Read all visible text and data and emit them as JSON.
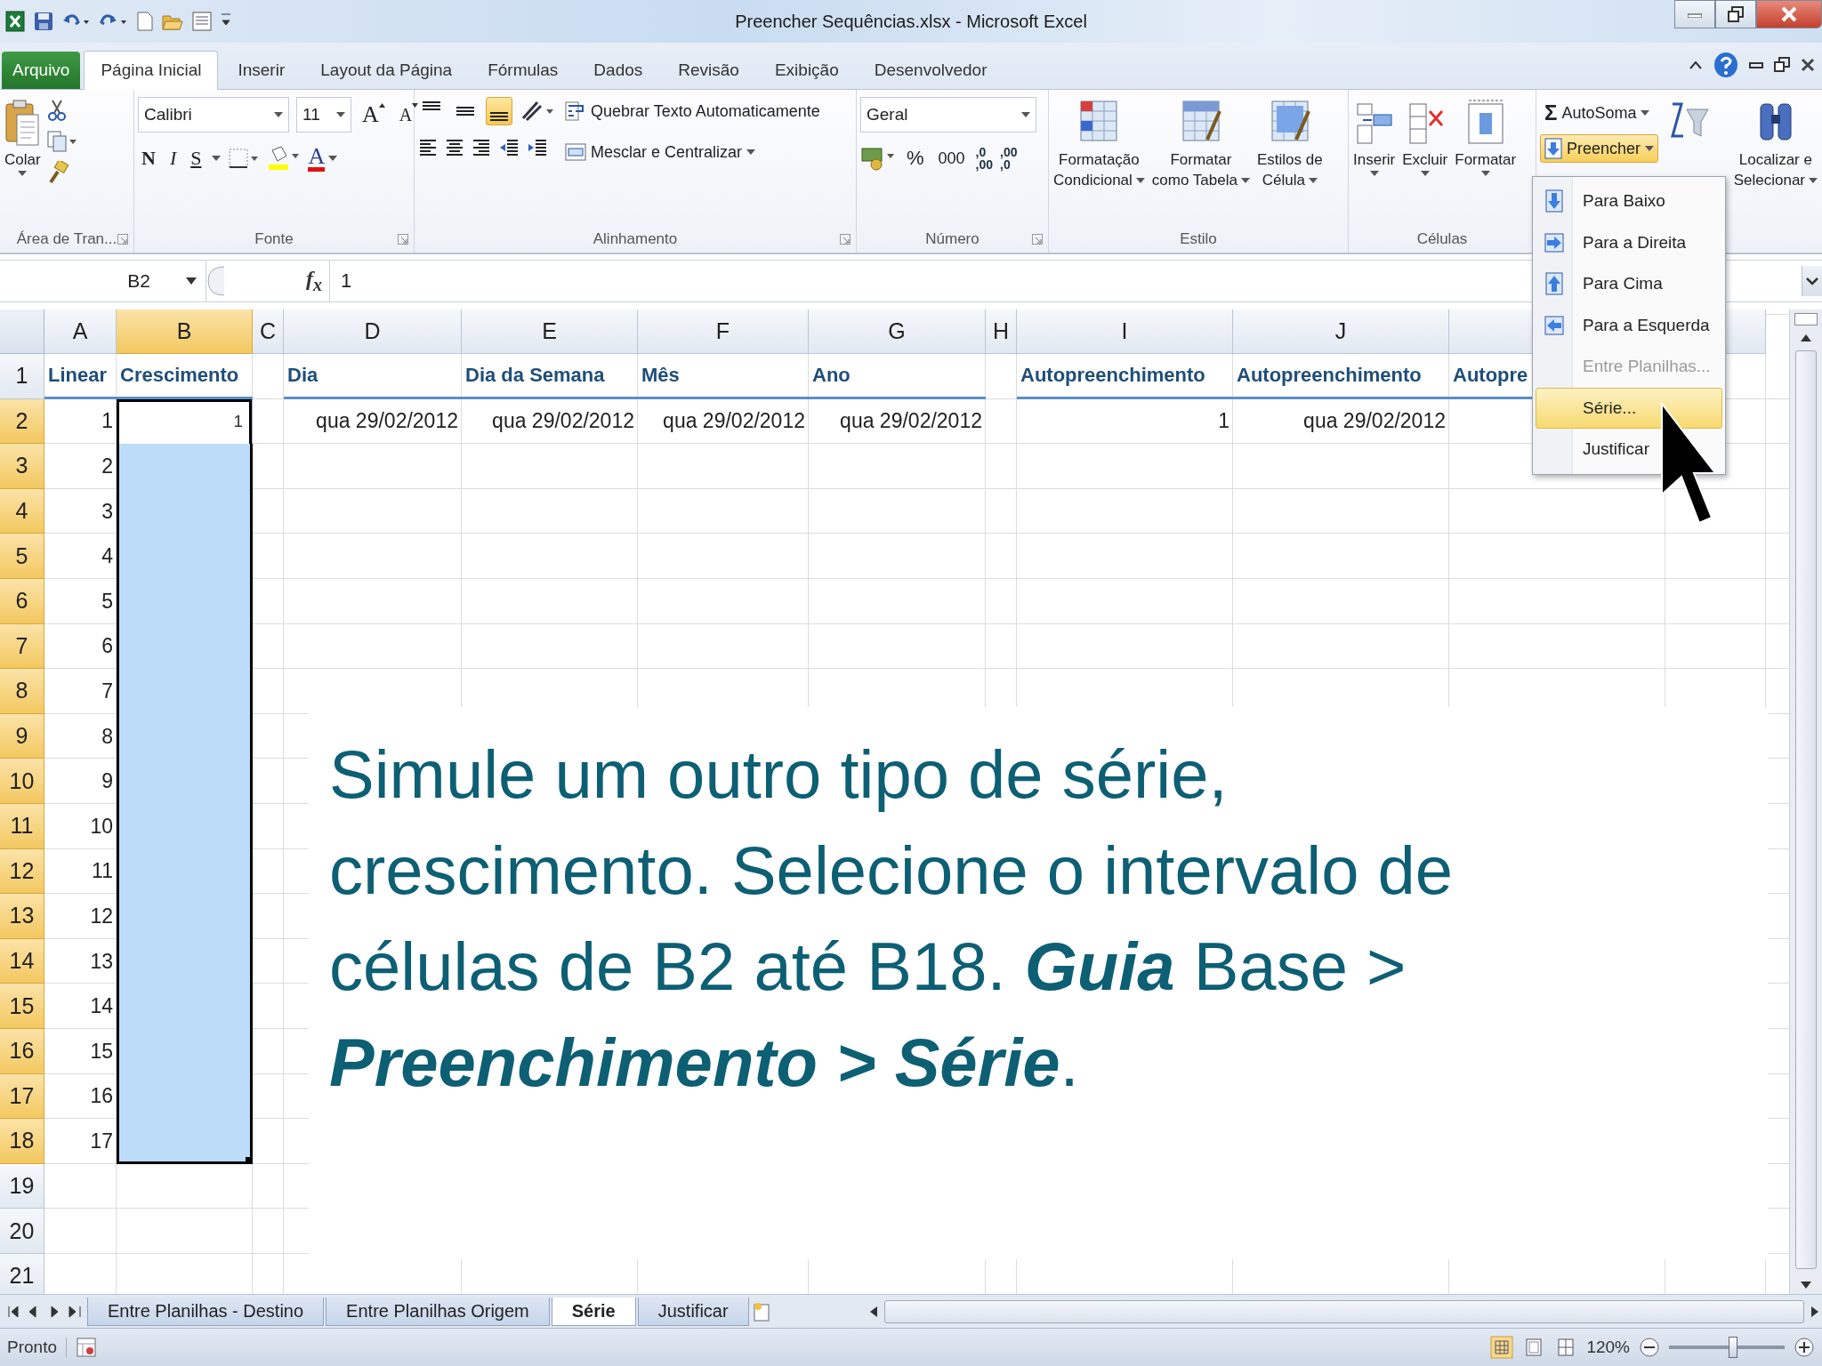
{
  "window": {
    "title": "Preencher Sequências.xlsx - Microsoft Excel"
  },
  "ribbon_tabs": [
    {
      "label": "Arquivo",
      "kind": "file",
      "selected": false
    },
    {
      "label": "Página Inicial",
      "kind": "tab",
      "selected": true
    },
    {
      "label": "Inserir",
      "kind": "tab",
      "selected": false
    },
    {
      "label": "Layout da Página",
      "kind": "tab",
      "selected": false
    },
    {
      "label": "Fórmulas",
      "kind": "tab",
      "selected": false
    },
    {
      "label": "Dados",
      "kind": "tab",
      "selected": false
    },
    {
      "label": "Revisão",
      "kind": "tab",
      "selected": false
    },
    {
      "label": "Exibição",
      "kind": "tab",
      "selected": false
    },
    {
      "label": "Desenvolvedor",
      "kind": "tab",
      "selected": false
    }
  ],
  "ribbon": {
    "clipboard": {
      "paste": "Colar",
      "label": "Área de Tran..."
    },
    "font": {
      "name": "Calibri",
      "size": "11",
      "grow": "A",
      "shrink": "A",
      "bold": "N",
      "italic": "I",
      "underline": "S",
      "font_color": "A",
      "label": "Fonte"
    },
    "alignment": {
      "vertical": [
        {
          "selected": false
        },
        {
          "selected": false
        },
        {
          "selected": true
        }
      ],
      "wrap_text": "Quebrar Texto Automaticamente",
      "merge": "Mesclar e Centralizar",
      "label": "Alinhamento"
    },
    "number": {
      "format": "Geral",
      "percent": "%",
      "thousands": "000",
      "decimals": [
        {
          "top": ",0",
          "bottom": ",00"
        },
        {
          "top": ",00",
          "bottom": ",0"
        }
      ],
      "label": "Número"
    },
    "styles": {
      "buttons": [
        {
          "lines": [
            "Formatação",
            "Condicional"
          ]
        },
        {
          "lines": [
            "Formatar",
            "como Tabela"
          ]
        },
        {
          "lines": [
            "Estilos de",
            "Célula"
          ]
        }
      ],
      "label": "Estilo"
    },
    "cells": {
      "buttons": [
        "Inserir",
        "Excluir",
        "Formatar"
      ],
      "label": "Células"
    },
    "editing": {
      "autosum_symbol": "Σ",
      "autosum": "AutoSoma",
      "fill": {
        "label": "Preencher",
        "expanded": true
      },
      "find": [
        "Localizar e",
        "Selecionar"
      ]
    }
  },
  "fill_menu": [
    {
      "label": "Para Baixo",
      "disabled": false,
      "selected": false
    },
    {
      "label": "Para a Direita",
      "disabled": false,
      "selected": false
    },
    {
      "label": "Para Cima",
      "disabled": false,
      "selected": false
    },
    {
      "label": "Para a Esquerda",
      "disabled": false,
      "selected": false
    },
    {
      "label": "Entre Planilhas...",
      "disabled": true,
      "selected": false
    },
    {
      "label": "Série...",
      "disabled": false,
      "selected": true
    },
    {
      "label": "Justificar",
      "disabled": false,
      "selected": false
    }
  ],
  "formula_bar": {
    "name_box": "B2",
    "function_label": "f$_{x}$",
    "value": "1"
  },
  "columns": [
    {
      "label": "A",
      "selected": false
    },
    {
      "label": "B",
      "selected": true
    },
    {
      "label": "C",
      "selected": false
    },
    {
      "label": "D",
      "selected": false
    },
    {
      "label": "E",
      "selected": false
    },
    {
      "label": "F",
      "selected": false
    },
    {
      "label": "G",
      "selected": false
    },
    {
      "label": "H",
      "selected": false
    },
    {
      "label": "I",
      "selected": false
    },
    {
      "label": "J",
      "selected": false
    },
    {
      "selected": false
    },
    {
      "selected": false
    }
  ],
  "rows": [
    {
      "header": "1",
      "kind": "header",
      "selected": false,
      "cells": [
        "Linear",
        "Crescimento",
        null,
        "Dia",
        "Dia da Semana",
        "Mês",
        "Ano",
        null,
        "Autopreenchimento",
        "Autopreenchimento",
        "Autopre"
      ]
    },
    {
      "header": "2",
      "kind": "data",
      "selected": true,
      "active": true,
      "cells": [
        "1",
        "1",
        null,
        "qua 29/02/2012",
        "qua 29/02/2012",
        "qua 29/02/2012",
        "qua 29/02/2012",
        null,
        "1",
        "qua 29/02/2012"
      ]
    },
    {
      "header": "3",
      "kind": "data",
      "selected": true,
      "cells": [
        "2"
      ]
    },
    {
      "header": "4",
      "kind": "data",
      "selected": true,
      "cells": [
        "3"
      ]
    },
    {
      "header": "5",
      "kind": "data",
      "selected": true,
      "cells": [
        "4"
      ]
    },
    {
      "header": "6",
      "kind": "data",
      "selected": true,
      "cells": [
        "5"
      ]
    },
    {
      "header": "7",
      "kind": "data",
      "selected": true,
      "cells": [
        "6"
      ]
    },
    {
      "header": "8",
      "kind": "data",
      "selected": true,
      "cells": [
        "7"
      ]
    },
    {
      "header": "9",
      "kind": "data",
      "selected": true,
      "cells": [
        "8"
      ]
    },
    {
      "header": "10",
      "kind": "data",
      "selected": true,
      "cells": [
        "9"
      ]
    },
    {
      "header": "11",
      "kind": "data",
      "selected": true,
      "cells": [
        "10"
      ]
    },
    {
      "header": "12",
      "kind": "data",
      "selected": true,
      "cells": [
        "11"
      ]
    },
    {
      "header": "13",
      "kind": "data",
      "selected": true,
      "cells": [
        "12"
      ]
    },
    {
      "header": "14",
      "kind": "data",
      "selected": true,
      "cells": [
        "13"
      ]
    },
    {
      "header": "15",
      "kind": "data",
      "selected": true,
      "cells": [
        "14"
      ]
    },
    {
      "header": "16",
      "kind": "data",
      "selected": true,
      "cells": [
        "15"
      ]
    },
    {
      "header": "17",
      "kind": "data",
      "selected": true,
      "cells": [
        "16"
      ]
    },
    {
      "header": "18",
      "kind": "data",
      "selected": true,
      "cells": [
        "17"
      ]
    },
    {
      "header": "19",
      "selected": false
    },
    {
      "header": "20",
      "selected": false
    },
    {
      "header": "21",
      "selected": false
    }
  ],
  "instruction_overlay": {
    "text": "Simule um outro tipo de série, crescimento. Selecione o intervalo de células de B2 até B18. **Guia** Base > **Preenchimento > Série**."
  },
  "sheet_tabs": [
    {
      "label": "Entre Planilhas - Destino",
      "selected": false
    },
    {
      "label": "Entre Planilhas Origem",
      "selected": false
    },
    {
      "label": "Série",
      "selected": true
    },
    {
      "label": "Justificar",
      "selected": false
    }
  ],
  "status_bar": {
    "status": "Pronto",
    "zoom": "120%",
    "zoom_slider": {
      "level": 0.55
    }
  }
}
